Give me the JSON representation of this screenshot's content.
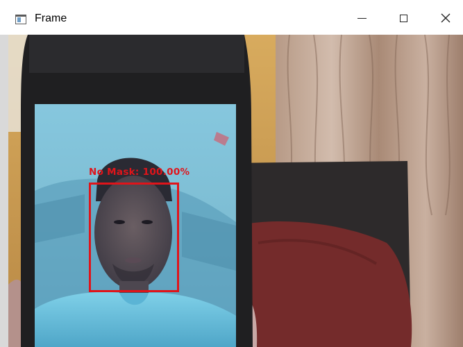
{
  "window": {
    "title": "Frame",
    "icon": "app-window-icon",
    "controls": {
      "minimize": "minimize-icon",
      "maximize": "maximize-icon",
      "close": "close-icon"
    }
  },
  "detection": {
    "label": "No Mask: 100.00%",
    "box_color": "#e0141a"
  }
}
